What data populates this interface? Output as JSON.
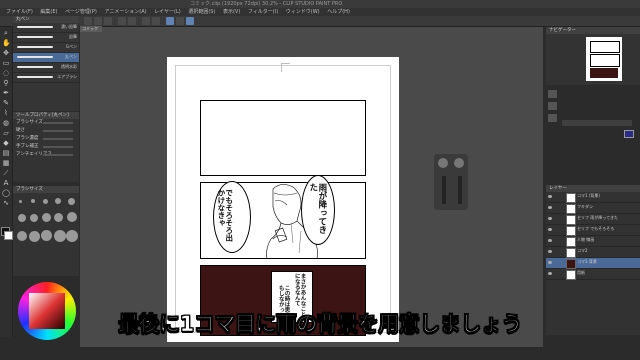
{
  "window": {
    "title": "コミック.clip (1920px 72dpi) 30.2% - CLIP STUDIO PAINT PRO"
  },
  "menu": {
    "items": [
      "ファイル(F)",
      "編集(E)",
      "ページ管理(P)",
      "アニメーション(A)",
      "レイヤー(L)",
      "選択範囲(S)",
      "表示(V)",
      "フィルター(I)",
      "ウィンドウ(W)",
      "ヘルプ(H)"
    ]
  },
  "subtool": {
    "header": "丸ペン",
    "brushes": [
      {
        "label": "濃い鉛筆"
      },
      {
        "label": "鉛筆"
      },
      {
        "label": "Gペン"
      },
      {
        "label": "丸ペン"
      },
      {
        "label": "透明水彩"
      },
      {
        "label": "エアブラシ"
      }
    ]
  },
  "tool_property": {
    "header": "ツールプロパティ[丸ペン]",
    "rows": [
      "ブラシサイズ",
      "硬さ",
      "ブラシ濃度",
      "手ブレ補正",
      "アンチエイリアス"
    ]
  },
  "brush_size": {
    "header": "ブラシサイズ"
  },
  "canvas": {
    "tab_label": "コミック"
  },
  "manga": {
    "bubble_right": "雨が降ってきた",
    "bubble_left": "でもそろそろ出かけなきゃ",
    "bubble_bottom_1": "まさかあんなことになるなんて",
    "bubble_bottom_2": "この時は思いもしなかった"
  },
  "navigator": {
    "label": "ナビゲーター"
  },
  "layers": {
    "header": "レイヤー",
    "rows": [
      {
        "name": "コマ1 (背景)",
        "selected": false
      },
      {
        "name": "フキダシ",
        "selected": false
      },
      {
        "name": "セリフ 雨が降ってきた",
        "selected": false
      },
      {
        "name": "セリフ でもそろそろ",
        "selected": false
      },
      {
        "name": "人物 線画",
        "selected": false
      },
      {
        "name": "コマ2",
        "selected": false
      },
      {
        "name": "コマ3 背景",
        "selected": true
      },
      {
        "name": "用紙",
        "selected": false
      }
    ]
  },
  "subtitle": {
    "text": "最後に1コマ目に雨の背景を用意しましょう"
  }
}
